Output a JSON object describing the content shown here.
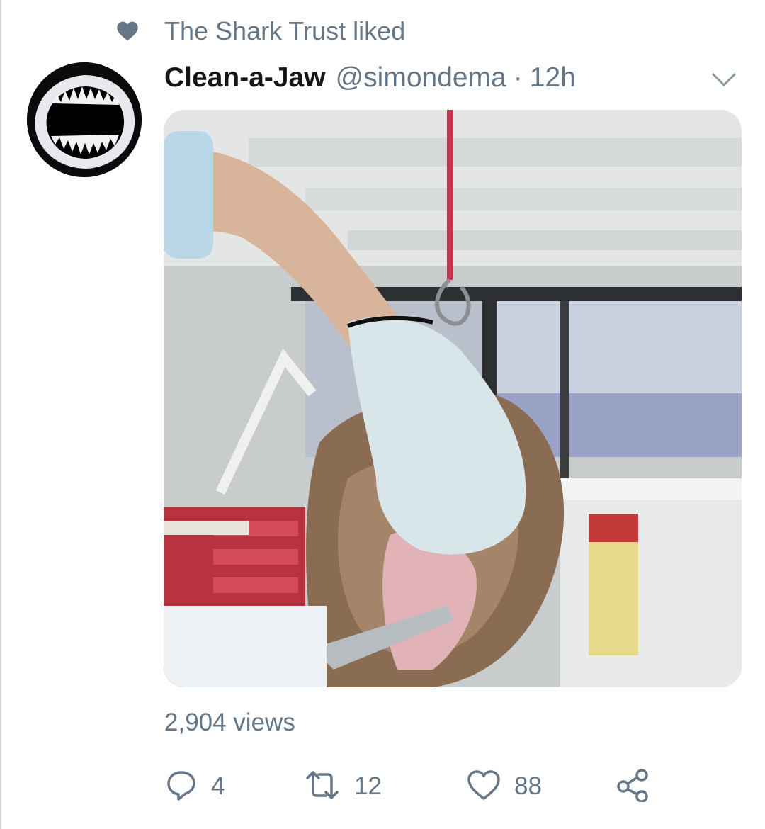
{
  "social_context": {
    "text": "The Shark Trust liked",
    "icon": "heart-icon"
  },
  "tweet": {
    "author_name": "Clean-a-Jaw",
    "author_handle": "@simondema",
    "separator": "·",
    "timestamp": "12h",
    "views": "2,904 views"
  },
  "actions": {
    "reply": {
      "icon": "reply-icon",
      "count": "4"
    },
    "retweet": {
      "icon": "retweet-icon",
      "count": "12"
    },
    "like": {
      "icon": "heart-outline-icon",
      "count": "88"
    },
    "share": {
      "icon": "share-icon"
    }
  },
  "colors": {
    "secondary_text": "#657786",
    "primary_text": "#14171a"
  }
}
